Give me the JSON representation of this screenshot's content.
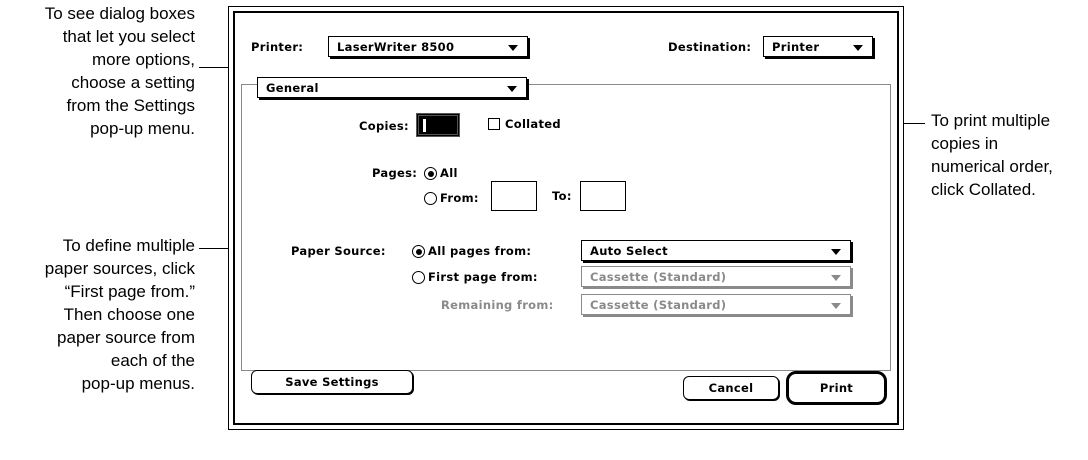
{
  "callouts": {
    "settings_popup": "To see dialog boxes\nthat let you select\nmore options,\nchoose a setting\nfrom the Settings\npop-up menu.",
    "paper_sources": "To define multiple\npaper sources, click\n“First page from.”\nThen choose one\npaper source from\neach of the\npop-up menus.",
    "collated": "To print multiple\ncopies in\nnumerical order,\nclick Collated."
  },
  "dialog": {
    "printer_label": "Printer:",
    "printer_value": "LaserWriter 8500",
    "destination_label": "Destination:",
    "destination_value": "Printer",
    "settings_value": "General",
    "copies_label": "Copies:",
    "copies_value": "1",
    "collated_label": "Collated",
    "collated_checked": false,
    "pages_label": "Pages:",
    "pages_all": "All",
    "pages_from": "From:",
    "pages_to": "To:",
    "pages_from_value": "",
    "pages_to_value": "",
    "pages_selected": "All",
    "paper_source_label": "Paper Source:",
    "all_pages_from": "All pages from:",
    "all_pages_value": "Auto Select",
    "first_page_from": "First page from:",
    "first_page_value": "Cassette (Standard)",
    "remaining_from": "Remaining from:",
    "remaining_value": "Cassette (Standard)",
    "paper_source_selected": "All pages from",
    "save_settings": "Save Settings",
    "cancel": "Cancel",
    "print": "Print"
  }
}
